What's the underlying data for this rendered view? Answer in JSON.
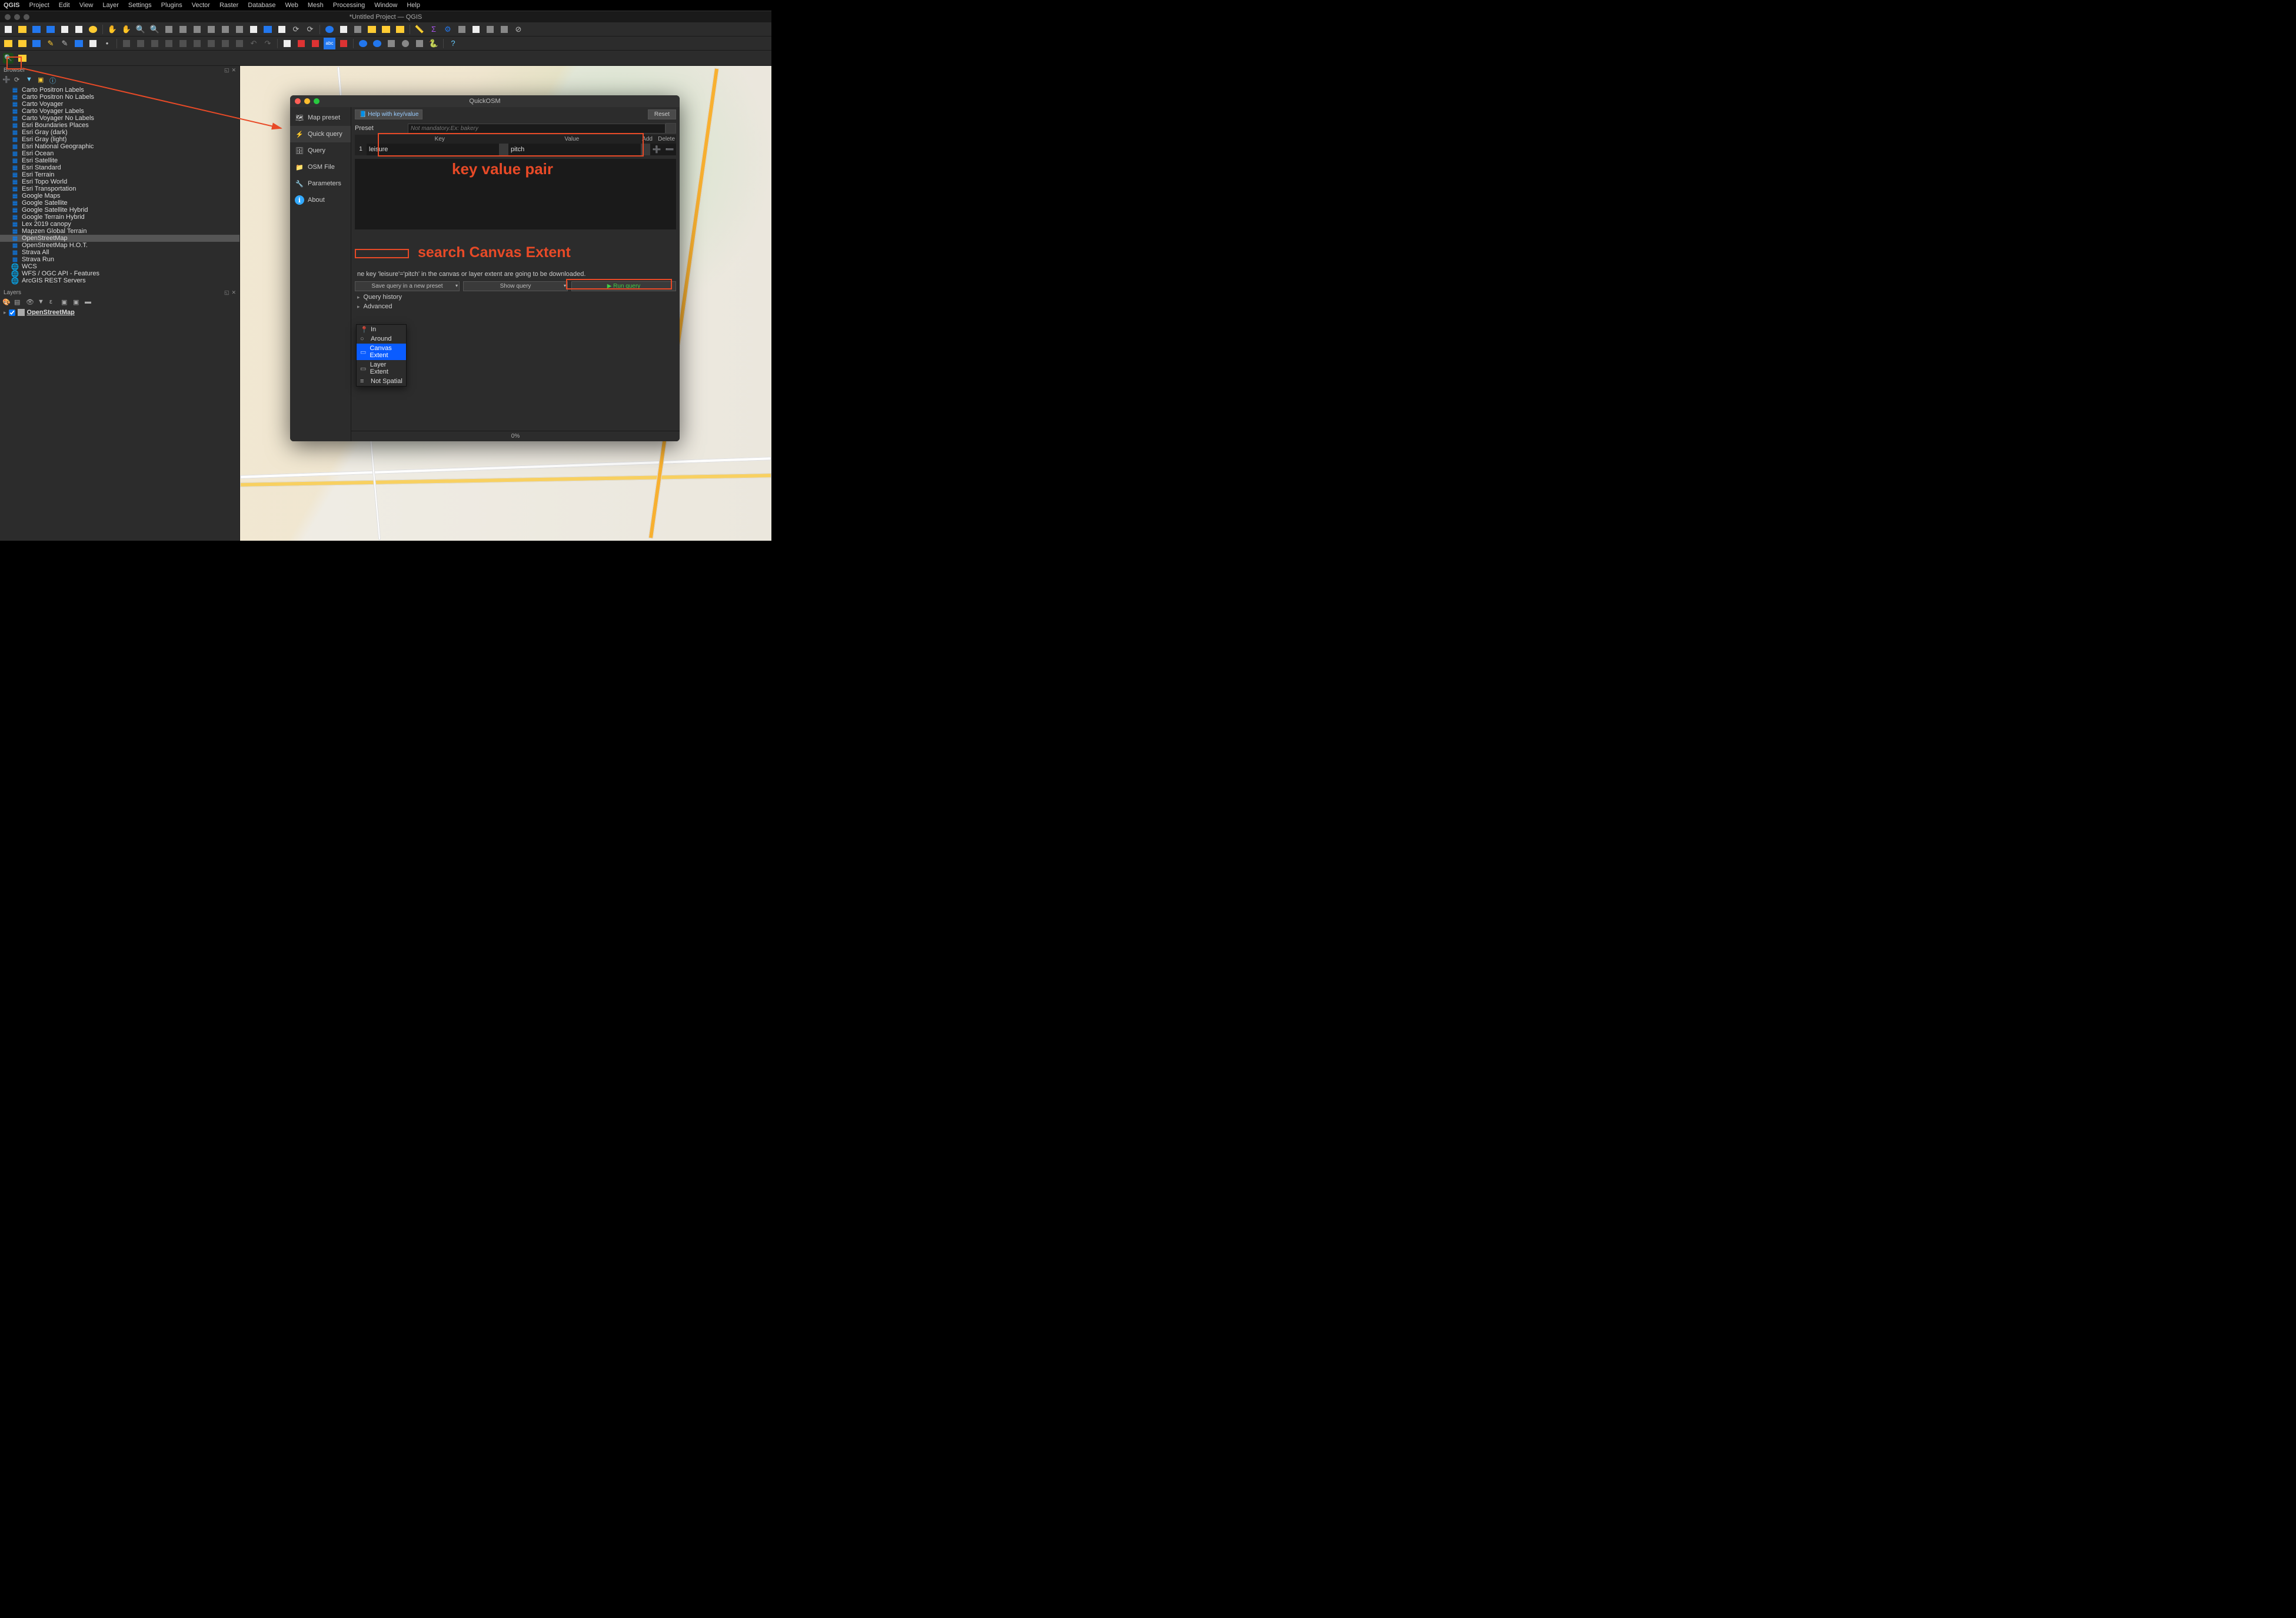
{
  "menubar": [
    "QGIS",
    "Project",
    "Edit",
    "View",
    "Layer",
    "Settings",
    "Plugins",
    "Vector",
    "Raster",
    "Database",
    "Web",
    "Mesh",
    "Processing",
    "Window",
    "Help"
  ],
  "window_title": "*Untitled Project — QGIS",
  "panels": {
    "browser_title": "Browser",
    "layers_title": "Layers"
  },
  "browser_items": [
    {
      "label": "Carto Positron Labels",
      "icon": "grid"
    },
    {
      "label": "Carto Positron No Labels",
      "icon": "grid"
    },
    {
      "label": "Carto Voyager",
      "icon": "grid"
    },
    {
      "label": "Carto Voyager Labels",
      "icon": "grid"
    },
    {
      "label": "Carto Voyager No Labels",
      "icon": "grid"
    },
    {
      "label": "Esri Boundaries Places",
      "icon": "grid"
    },
    {
      "label": "Esri Gray (dark)",
      "icon": "grid"
    },
    {
      "label": "Esri Gray (light)",
      "icon": "grid"
    },
    {
      "label": "Esri National Geographic",
      "icon": "grid"
    },
    {
      "label": "Esri Ocean",
      "icon": "grid"
    },
    {
      "label": "Esri Satellite",
      "icon": "grid"
    },
    {
      "label": "Esri Standard",
      "icon": "grid"
    },
    {
      "label": "Esri Terrain",
      "icon": "grid"
    },
    {
      "label": "Esri Topo World",
      "icon": "grid"
    },
    {
      "label": "Esri Transportation",
      "icon": "grid"
    },
    {
      "label": "Google Maps",
      "icon": "grid"
    },
    {
      "label": "Google Satellite",
      "icon": "grid"
    },
    {
      "label": "Google Satellite Hybrid",
      "icon": "grid"
    },
    {
      "label": "Google Terrain Hybrid",
      "icon": "grid"
    },
    {
      "label": "Lex 2019 canopy",
      "icon": "grid"
    },
    {
      "label": "Mapzen Global Terrain",
      "icon": "grid"
    },
    {
      "label": "OpenStreetMap",
      "icon": "grid",
      "selected": true
    },
    {
      "label": "OpenStreetMap H.O.T.",
      "icon": "grid"
    },
    {
      "label": "Strava All",
      "icon": "grid"
    },
    {
      "label": "Strava Run",
      "icon": "grid"
    },
    {
      "label": "WCS",
      "icon": "globe"
    },
    {
      "label": "WFS / OGC API - Features",
      "icon": "globe"
    },
    {
      "label": "ArcGIS REST Servers",
      "icon": "globe"
    }
  ],
  "layers": [
    {
      "label": "OpenStreetMap",
      "checked": true
    }
  ],
  "quickosm": {
    "title": "QuickOSM",
    "side_items": [
      {
        "label": "Map preset",
        "icon": "map"
      },
      {
        "label": "Quick query",
        "icon": "bolt",
        "active": true
      },
      {
        "label": "Query",
        "icon": "db"
      },
      {
        "label": "OSM File",
        "icon": "folder"
      },
      {
        "label": "Parameters",
        "icon": "wrench"
      },
      {
        "label": "About",
        "icon": "info"
      }
    ],
    "help_label": "Help with key/value",
    "reset_label": "Reset",
    "preset_label": "Preset",
    "preset_placeholder": "Not mandatory.Ex: bakery",
    "kv_headers": {
      "key": "Key",
      "value": "Value",
      "add": "Add",
      "delete": "Delete"
    },
    "kv_row": {
      "num": "1",
      "key": "leisure",
      "value": "pitch"
    },
    "extent_options": [
      {
        "label": "In",
        "icon": "pin"
      },
      {
        "label": "Around",
        "icon": "circle"
      },
      {
        "label": "Canvas Extent",
        "icon": "rect",
        "selected": true
      },
      {
        "label": "Layer Extent",
        "icon": "rect"
      },
      {
        "label": "Not Spatial",
        "icon": "lines"
      }
    ],
    "desc_text": "ne key 'leisure'='pitch' in the canvas or layer extent are going to be downloaded.",
    "save_btn": "Save query in a new preset",
    "show_btn": "Show query",
    "run_btn": "Run query",
    "history_label": "Query history",
    "advanced_label": "Advanced",
    "progress": "0%"
  },
  "annotations": {
    "kv_label": "key value pair",
    "extent_label": "search Canvas Extent"
  }
}
